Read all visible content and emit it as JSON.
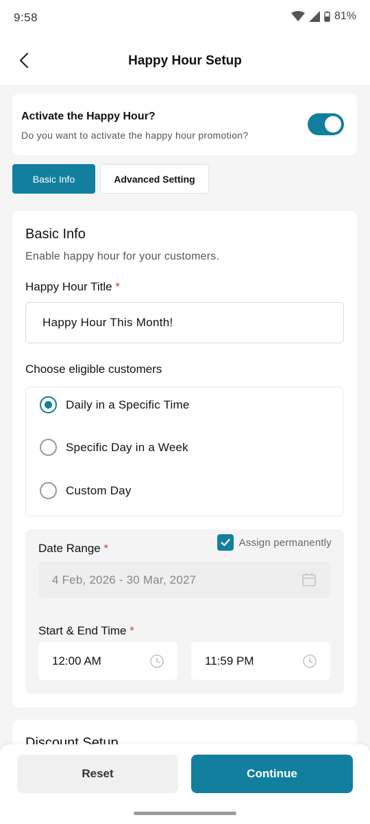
{
  "status_bar": {
    "time": "9:58",
    "battery": "81%"
  },
  "header": {
    "title": "Happy Hour Setup"
  },
  "activation": {
    "title": "Activate the Happy Hour?",
    "subtitle": "Do you want to activate the happy hour promotion?",
    "enabled": true
  },
  "tabs": [
    {
      "label": "Basic Info",
      "active": true
    },
    {
      "label": "Advanced Setting",
      "active": false
    }
  ],
  "basic_info": {
    "title": "Basic Info",
    "subtitle": "Enable happy hour for your customers.",
    "title_field": {
      "label": "Happy Hour Title",
      "required_mark": "*",
      "value": "Happy Hour This Month!"
    },
    "eligible": {
      "label": "Choose eligible customers",
      "options": [
        {
          "label": "Daily in a Specific Time",
          "selected": true
        },
        {
          "label": "Specific Day in a Week",
          "selected": false
        },
        {
          "label": "Custom Day",
          "selected": false
        }
      ]
    },
    "date_range": {
      "label": "Date Range",
      "required_mark": "*",
      "assign_label": "Assign permanently",
      "assign_checked": true,
      "value": "4 Feb, 2026 - 30 Mar, 2027"
    },
    "time": {
      "label": "Start & End Time",
      "required_mark": "*",
      "start": "12:00 AM",
      "end": "11:59 PM"
    }
  },
  "discount": {
    "title": "Discount Setup"
  },
  "actions": {
    "reset": "Reset",
    "continue": "Continue"
  },
  "colors": {
    "accent": "#127f9f",
    "required": "#d9372d"
  }
}
